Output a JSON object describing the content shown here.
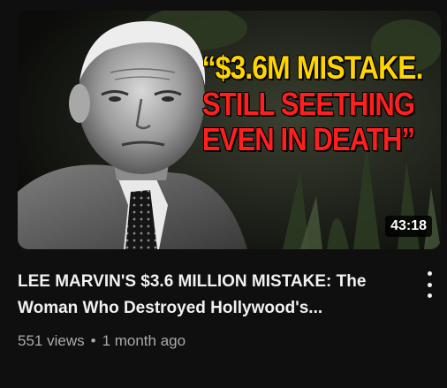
{
  "video": {
    "thumbnail": {
      "headline_line1": "“$3.6M MISTAKE.",
      "headline_line2": "STILL SEETHING",
      "headline_line3": "EVEN IN DEATH”",
      "duration": "43:18"
    },
    "title": "LEE MARVIN'S $3.6 MILLION MISTAKE: The Woman Who Destroyed Hollywood's...",
    "views": "551 views",
    "separator": "•",
    "age": "1 month ago",
    "menu_icon": "more-vert-icon"
  },
  "colors": {
    "background": "#0f0f0f",
    "headline_yellow": "#ffd400",
    "headline_red": "#ff1f1f",
    "title_text": "#f1f1f1",
    "meta_text": "#aaaaaa"
  }
}
